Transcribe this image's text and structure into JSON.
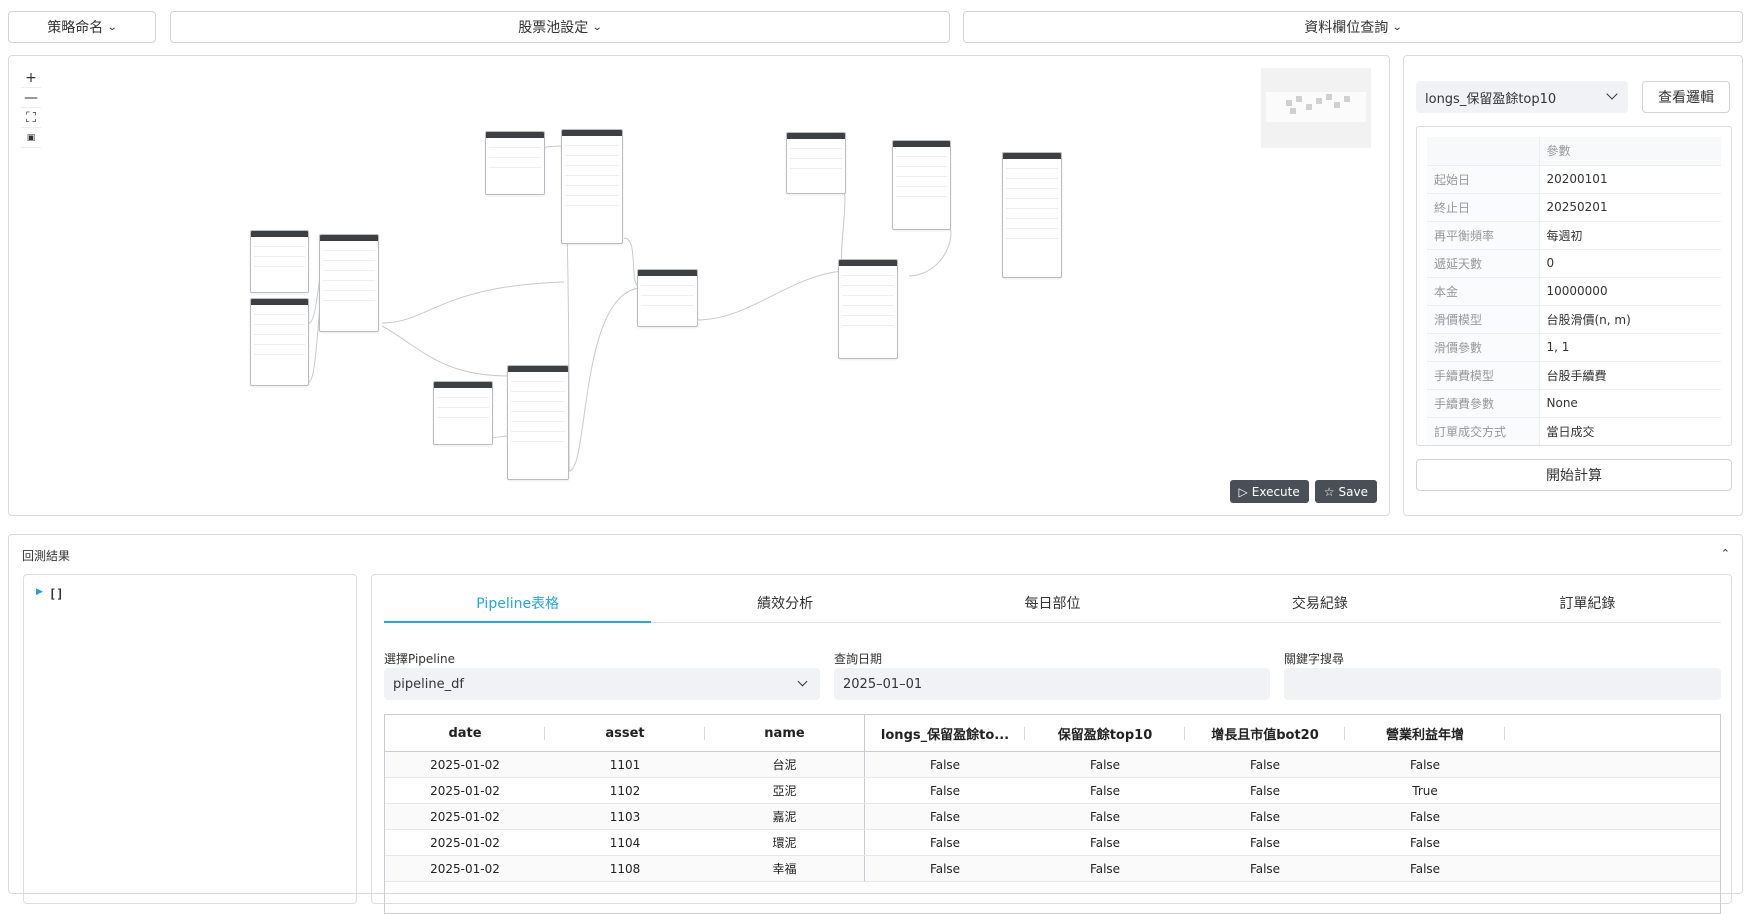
{
  "topbar": {
    "strategy_naming": "策略命名",
    "stock_pool_settings": "股票池設定",
    "data_field_query": "資料欄位查詢"
  },
  "canvas": {
    "zoom_in": "+",
    "zoom_out": "—",
    "fit": "⛶",
    "lock": "🔒",
    "execute_label": "Execute",
    "save_label": "Save"
  },
  "right_panel": {
    "selected_strategy": "longs_保留盈餘top10",
    "view_logic_label": "查看邏輯",
    "param_header": "參數",
    "params": [
      {
        "key": "起始日",
        "value": "20200101"
      },
      {
        "key": "終止日",
        "value": "20250201"
      },
      {
        "key": "再平衡頻率",
        "value": "每週初"
      },
      {
        "key": "遞延天數",
        "value": "0"
      },
      {
        "key": "本金",
        "value": "10000000"
      },
      {
        "key": "滑價模型",
        "value": "台股滑價(n, m)"
      },
      {
        "key": "滑價參數",
        "value": "1, 1"
      },
      {
        "key": "手續費模型",
        "value": "台股手續費"
      },
      {
        "key": "手續費參數",
        "value": "None"
      },
      {
        "key": "訂單成交方式",
        "value": "當日成交"
      }
    ],
    "start_calc_label": "開始計算"
  },
  "results": {
    "title": "回測結果",
    "json_value": "[]",
    "tabs": [
      "Pipeline表格",
      "績效分析",
      "每日部位",
      "交易紀錄",
      "訂單紀錄"
    ],
    "active_tab": 0,
    "select_pipeline_label": "選擇Pipeline",
    "select_pipeline_value": "pipeline_df",
    "query_date_label": "查詢日期",
    "query_date_value": "2025–01–01",
    "keyword_label": "關鍵字搜尋",
    "keyword_value": "",
    "columns": [
      "date",
      "asset",
      "name",
      "longs_保留盈餘to...",
      "保留盈餘top10",
      "增長且市值bot20",
      "營業利益年增"
    ],
    "rows": [
      [
        "2025-01-02",
        "1101",
        "台泥",
        "False",
        "False",
        "False",
        "False"
      ],
      [
        "2025-01-02",
        "1102",
        "亞泥",
        "False",
        "False",
        "False",
        "True"
      ],
      [
        "2025-01-02",
        "1103",
        "嘉泥",
        "False",
        "False",
        "False",
        "False"
      ],
      [
        "2025-01-02",
        "1104",
        "環泥",
        "False",
        "False",
        "False",
        "False"
      ],
      [
        "2025-01-02",
        "1108",
        "幸福",
        "False",
        "False",
        "False",
        "False"
      ]
    ]
  },
  "colors": {
    "accent": "#27a6d9",
    "node_header": "#3d3f43",
    "canvas_button": "#4a4f57"
  }
}
